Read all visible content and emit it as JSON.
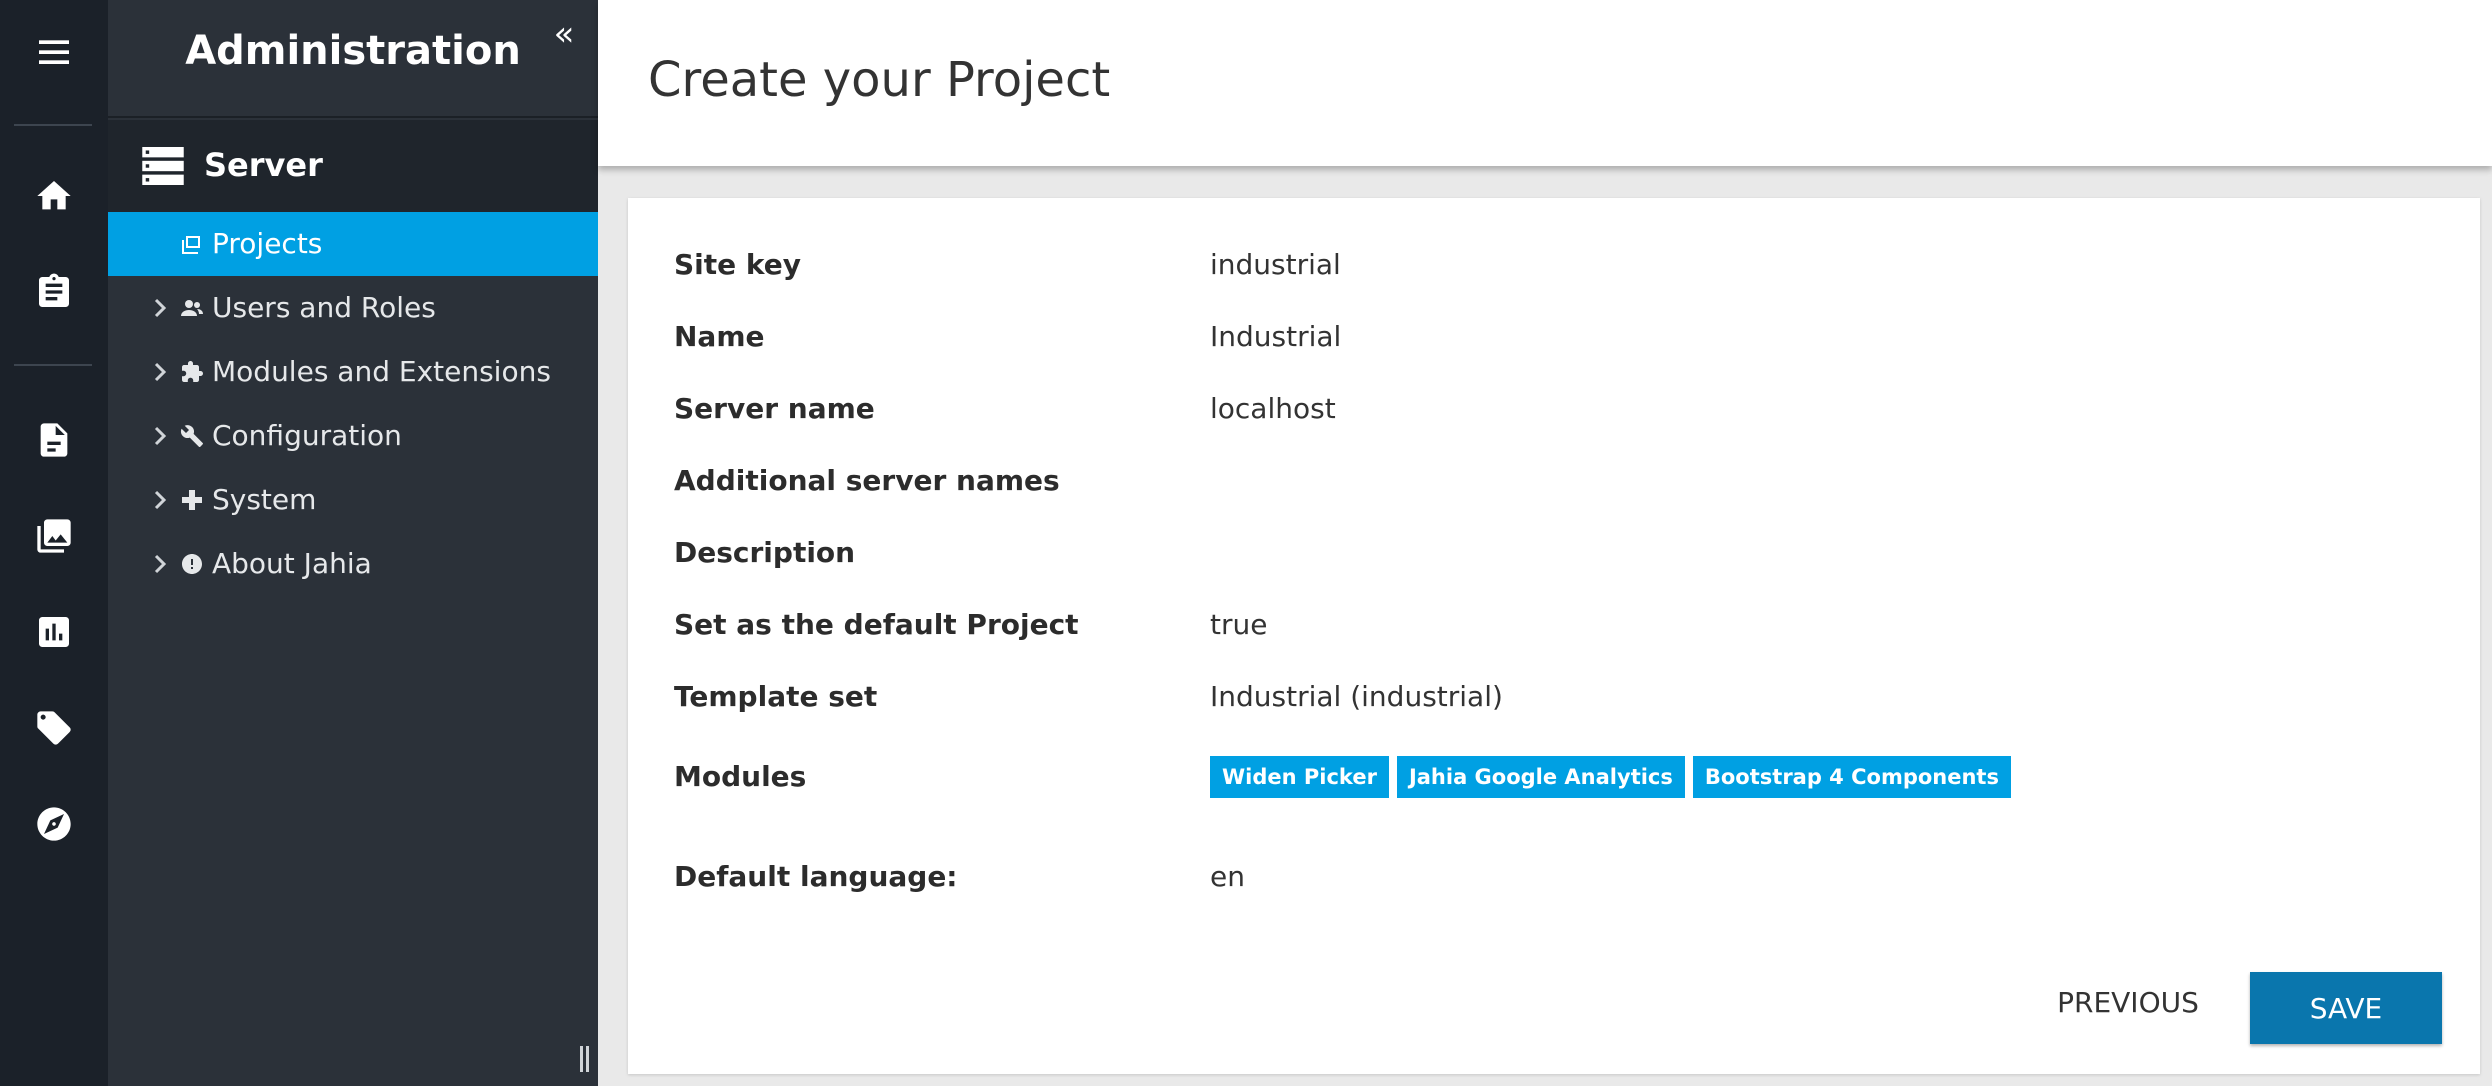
{
  "rail": {
    "icons": [
      "hamburger-menu-icon",
      "home-icon",
      "clipboard-icon",
      "pages-icon",
      "media-icon",
      "analytics-icon",
      "tag-icon",
      "compass-icon"
    ]
  },
  "nav": {
    "title": "Administration",
    "collapse_glyph": "«",
    "section_label": "Server",
    "items": [
      {
        "label": "Projects",
        "icon": "projects-icon",
        "active": true
      },
      {
        "label": "Users and Roles",
        "icon": "users-icon"
      },
      {
        "label": "Modules and Extensions",
        "icon": "puzzle-icon"
      },
      {
        "label": "Configuration",
        "icon": "wrench-icon"
      },
      {
        "label": "System",
        "icon": "plus-icon"
      },
      {
        "label": "About Jahia",
        "icon": "info-icon"
      }
    ]
  },
  "header": {
    "title": "Create your Project"
  },
  "summary": {
    "site_key": {
      "label": "Site key",
      "value": "industrial"
    },
    "name": {
      "label": "Name",
      "value": "Industrial"
    },
    "server_name": {
      "label": "Server name",
      "value": "localhost"
    },
    "additional_server_names": {
      "label": "Additional server names",
      "value": ""
    },
    "description": {
      "label": "Description",
      "value": ""
    },
    "default_project": {
      "label": "Set as the default Project",
      "value": "true"
    },
    "template_set": {
      "label": "Template set",
      "value": "Industrial (industrial)"
    },
    "modules": {
      "label": "Modules",
      "values": [
        "Widen Picker",
        "Jahia Google Analytics",
        "Bootstrap 4 Components"
      ]
    },
    "default_language": {
      "label": "Default language:",
      "value": "en"
    }
  },
  "actions": {
    "previous_label": "PREVIOUS",
    "save_label": "SAVE"
  },
  "colors": {
    "accent": "#00a0e3",
    "save_button": "#0a76ad",
    "rail_bg": "#1b2129",
    "nav_bg": "#2b3139"
  }
}
